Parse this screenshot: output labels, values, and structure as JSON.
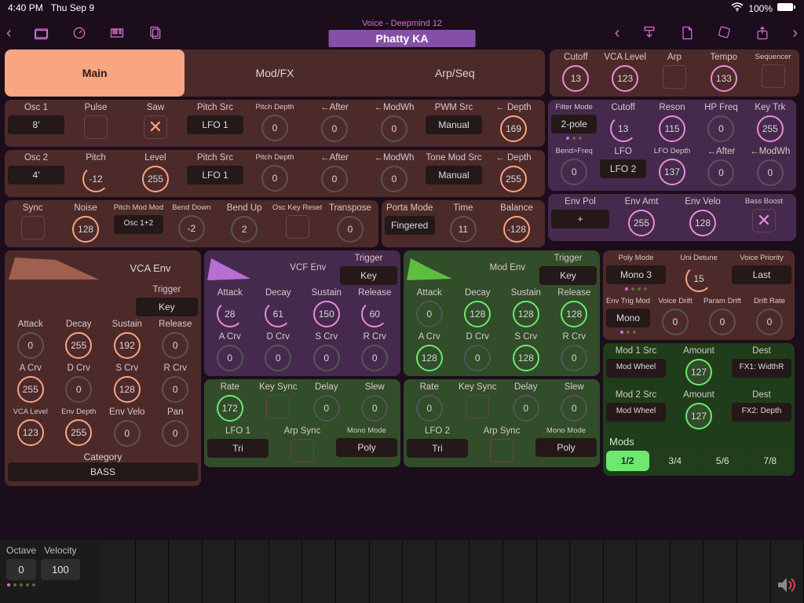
{
  "status": {
    "time": "4:40 PM",
    "date": "Thu Sep 9",
    "battery": "100%"
  },
  "header": {
    "voice": "Voice - Deepmind 12",
    "patch": "Phatty KA"
  },
  "tabs": [
    "Main",
    "Mod/FX",
    "Arp/Seq"
  ],
  "toprow": {
    "cutoff": {
      "l": "Cutoff",
      "v": "13"
    },
    "vca": {
      "l": "VCA Level",
      "v": "123"
    },
    "arp": {
      "l": "Arp"
    },
    "tempo": {
      "l": "Tempo",
      "v": "133"
    },
    "seq": {
      "l": "Sequencer"
    }
  },
  "osc1": {
    "title": "Osc 1",
    "range": "8'",
    "pulse": "Pulse",
    "saw": "Saw",
    "pitchsrc": {
      "l": "Pitch Src",
      "v": "LFO 1"
    },
    "pitchdepth": {
      "l": "Pitch Depth",
      "v": "0"
    },
    "after": {
      "l": "←After",
      "v": "0"
    },
    "modwh": {
      "l": "←ModWh",
      "v": "0"
    },
    "pwmsrc": {
      "l": "PWM Src",
      "v": "Manual"
    },
    "depth": {
      "l": "← Depth",
      "v": "169"
    }
  },
  "osc2": {
    "title": "Osc 2",
    "range": "4'",
    "pitch": {
      "l": "Pitch",
      "v": "-12"
    },
    "level": {
      "l": "Level",
      "v": "255"
    },
    "pitchsrc": {
      "l": "Pitch Src",
      "v": "LFO 1"
    },
    "pitchdepth": {
      "l": "Pitch Depth",
      "v": "0"
    },
    "after": {
      "l": "←After",
      "v": "0"
    },
    "modwh": {
      "l": "←ModWh",
      "v": "0"
    },
    "tmsrc": {
      "l": "Tone Mod Src",
      "v": "Manual"
    },
    "depth": {
      "l": "← Depth",
      "v": "255"
    }
  },
  "oscmisc": {
    "sync": "Sync",
    "noise": {
      "l": "Noise",
      "v": "128"
    },
    "pmm": {
      "l": "Pitch Mod Mode",
      "v": "Osc 1+2"
    },
    "bdown": {
      "l": "Bend Down",
      "v": "-2"
    },
    "bup": {
      "l": "Bend Up",
      "v": "2"
    },
    "okr": {
      "l": "Osc Key Reset"
    },
    "transpose": {
      "l": "Transpose",
      "v": "0"
    }
  },
  "porta": {
    "mode": {
      "l": "Porta Mode",
      "v": "Fingered"
    },
    "time": {
      "l": "Time",
      "v": "11"
    },
    "bal": {
      "l": "Balance",
      "v": "-128"
    }
  },
  "filter1": {
    "mode": {
      "l": "Filter Mode",
      "v": "2-pole"
    },
    "cutoff": {
      "l": "Cutoff",
      "v": "13"
    },
    "reson": {
      "l": "Reson",
      "v": "115"
    },
    "hp": {
      "l": "HP Freq",
      "v": "0"
    },
    "kt": {
      "l": "Key Trk",
      "v": "255"
    }
  },
  "filter2": {
    "bend": {
      "l": "Bend>Freq",
      "v": "0"
    },
    "lfo": {
      "l": "LFO",
      "v": "LFO 2"
    },
    "lfod": {
      "l": "LFO Depth",
      "v": "137"
    },
    "after": {
      "l": "←After",
      "v": "0"
    },
    "modwh": {
      "l": "←ModWh",
      "v": "0"
    }
  },
  "env": {
    "pol": {
      "l": "Env Pol",
      "v": "+"
    },
    "amt": {
      "l": "Env Amt",
      "v": "255"
    },
    "velo": {
      "l": "Env Velo",
      "v": "128"
    },
    "bass": {
      "l": "Bass Boost"
    }
  },
  "vcaenv": {
    "title": "VCA Env",
    "trigger": "Trigger",
    "trigv": "Key",
    "attack": "0",
    "decay": "255",
    "sustain": "192",
    "release": "0",
    "acrv": "255",
    "dcrv": "0",
    "scrv": "128",
    "rcrv": "0",
    "vca": {
      "l": "VCA Level",
      "v": "123"
    },
    "envd": {
      "l": "Env Depth",
      "v": "255"
    },
    "envv": {
      "l": "Env Velo",
      "v": "0"
    },
    "pan": {
      "l": "Pan",
      "v": "0"
    },
    "cat": {
      "l": "Category",
      "v": "BASS"
    }
  },
  "vcfenv": {
    "title": "VCF Env",
    "trigger": "Trigger",
    "trigv": "Key",
    "attack": "28",
    "decay": "61",
    "sustain": "150",
    "release": "60",
    "acrv": "0",
    "dcrv": "0",
    "scrv": "0",
    "rcrv": "0"
  },
  "modenv": {
    "title": "Mod Env",
    "trigger": "Trigger",
    "trigv": "Key",
    "attack": "0",
    "decay": "128",
    "sustain": "128",
    "release": "128",
    "acrv": "128",
    "dcrv": "0",
    "scrv": "128",
    "rcrv": "0"
  },
  "lfo1": {
    "rate": {
      "l": "Rate",
      "v": "172"
    },
    "ks": {
      "l": "Key Sync"
    },
    "delay": {
      "l": "Delay",
      "v": "0"
    },
    "slew": {
      "l": "Slew",
      "v": "0"
    },
    "name": {
      "l": "LFO 1",
      "v": "Tri"
    },
    "arp": {
      "l": "Arp Sync"
    },
    "mono": {
      "l": "Mono Mode",
      "v": "Poly"
    }
  },
  "lfo2": {
    "rate": {
      "l": "Rate",
      "v": "0"
    },
    "ks": {
      "l": "Key Sync"
    },
    "delay": {
      "l": "Delay",
      "v": "0"
    },
    "slew": {
      "l": "Slew",
      "v": "0"
    },
    "name": {
      "l": "LFO 2",
      "v": "Tri"
    },
    "arp": {
      "l": "Arp Sync"
    },
    "mono": {
      "l": "Mono Mode",
      "v": "Poly"
    }
  },
  "poly": {
    "mode": {
      "l": "Poly Mode",
      "v": "Mono 3"
    },
    "uni": {
      "l": "Uni Detune",
      "v": "15"
    },
    "vp": {
      "l": "Voice Priority",
      "v": "Last"
    },
    "etm": {
      "l": "Env Trig Mode",
      "v": "Mono"
    },
    "vdrift": {
      "l": "Voice Drift",
      "v": "0"
    },
    "pdrift": {
      "l": "Param Drift",
      "v": "0"
    },
    "drate": {
      "l": "Drift Rate",
      "v": "0"
    }
  },
  "mods": {
    "m1": {
      "src": {
        "l": "Mod 1 Src",
        "v": "Mod Wheel"
      },
      "amt": {
        "l": "Amount",
        "v": "127"
      },
      "dst": {
        "l": "Dest",
        "v": "FX1: WidthR"
      }
    },
    "m2": {
      "src": {
        "l": "Mod 2 Src",
        "v": "Mod Wheel"
      },
      "amt": {
        "l": "Amount",
        "v": "127"
      },
      "dst": {
        "l": "Dest",
        "v": "FX2: Depth"
      }
    },
    "title": "Mods",
    "pages": [
      "1/2",
      "3/4",
      "5/6",
      "7/8"
    ]
  },
  "labels": {
    "attack": "Attack",
    "decay": "Decay",
    "sustain": "Sustain",
    "release": "Release",
    "acrv": "A Crv",
    "dcrv": "D Crv",
    "scrv": "S Crv",
    "rcrv": "R Crv"
  },
  "bottom": {
    "octave": {
      "l": "Octave",
      "v": "0"
    },
    "velocity": {
      "l": "Velocity",
      "v": "100"
    }
  }
}
